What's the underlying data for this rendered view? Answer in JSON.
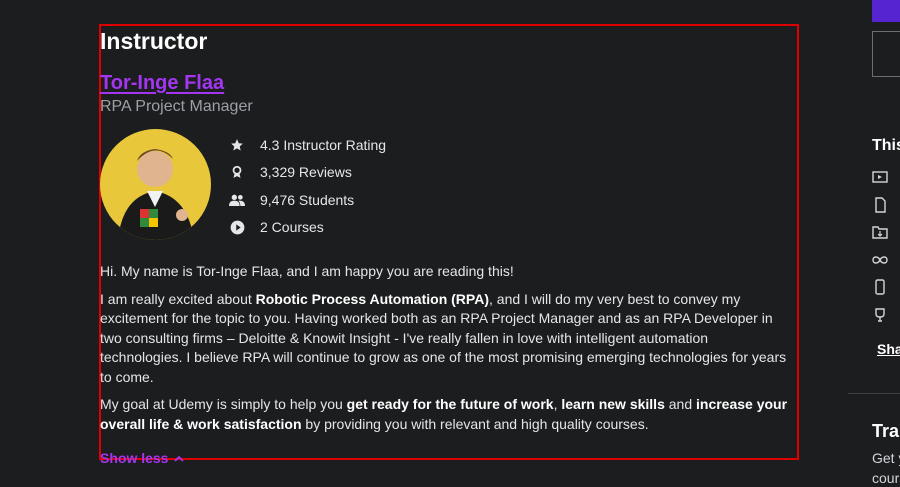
{
  "instructor": {
    "section_title": "Instructor",
    "name": "Tor-Inge Flaa",
    "job_title": "RPA Project Manager",
    "stats": [
      {
        "icon": "star-icon",
        "label": "4.3 Instructor Rating"
      },
      {
        "icon": "award-icon",
        "label": "3,329 Reviews"
      },
      {
        "icon": "people-icon",
        "label": "9,476 Students"
      },
      {
        "icon": "play-circle-icon",
        "label": "2 Courses"
      }
    ],
    "bio": {
      "p1": "Hi. My name is Tor-Inge Flaa, and I am happy you are reading this!",
      "p2_a": "I am really excited about ",
      "p2_b": "Robotic Process Automation (RPA)",
      "p2_c": ", and I will do my very best to convey my excitement for the topic to you. Having worked both as an RPA Project Manager and as an RPA Developer in two consulting firms – Deloitte & Knowit Insight - I've really fallen in love with intelligent automation technologies. I believe RPA will continue to grow as one of the most promising emerging technologies for years to come.",
      "p3_a": "My goal at Udemy is simply to help you ",
      "p3_b": "get ready for the future of work",
      "p3_c": ", ",
      "p3_d": "learn new skills",
      "p3_e": " and ",
      "p3_f": "increase your overall life & work satisfaction",
      "p3_g": " by providing you with relevant and high quality courses."
    },
    "show_less_label": "Show less"
  },
  "sidebar": {
    "title_partial": "This",
    "share_partial": "Sha",
    "train_partial": "Trai",
    "text_line1": "Get y",
    "text_line2": "cours"
  },
  "colors": {
    "accent": "#a435f0",
    "background": "#1c1d1f",
    "highlight": "#e00000"
  }
}
